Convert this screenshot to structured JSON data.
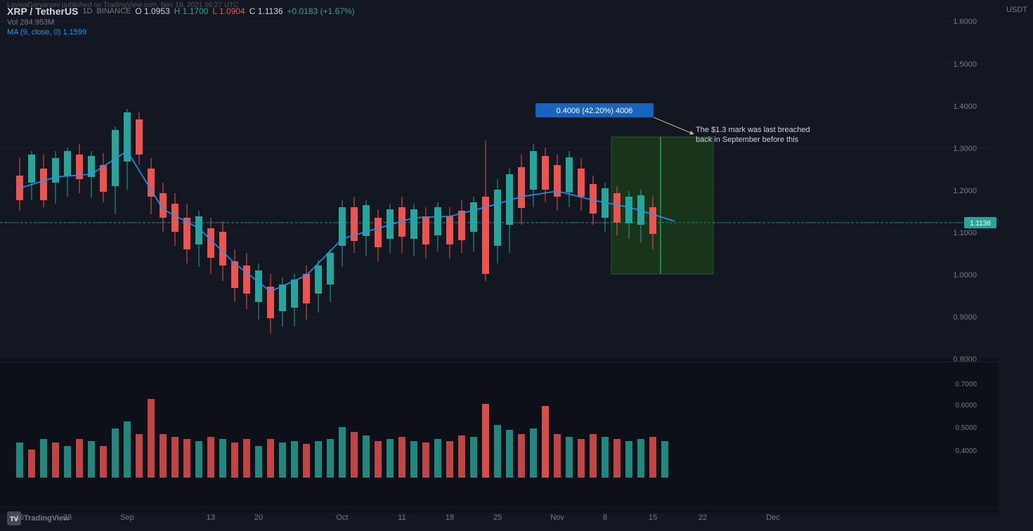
{
  "header": {
    "publisher": "LavinaDaryanani published on TradingView.com, Nov 18, 2021 06:27 UTC",
    "symbol": "XRP / TetherUS",
    "exchange": "BINANCE",
    "timeframe": "1D",
    "open_label": "O",
    "open_value": "1.0953",
    "high_label": "H",
    "high_value": "1.1700",
    "low_label": "L",
    "low_value": "1.0904",
    "close_label": "C",
    "close_value": "1.1136",
    "change_value": "+0.0183 (+1.67%)",
    "vol_label": "Vol",
    "vol_value": "284.953M",
    "ma_label": "MA (9, close, 0)",
    "ma_value": "1.1599"
  },
  "price_axis": {
    "currency": "USDT",
    "levels": [
      {
        "label": "1.6000",
        "y_pct": 4
      },
      {
        "label": "1.5000",
        "y_pct": 12
      },
      {
        "label": "1.4000",
        "y_pct": 20
      },
      {
        "label": "1.3000",
        "y_pct": 28
      },
      {
        "label": "1.2000",
        "y_pct": 36
      },
      {
        "label": "1.1136",
        "y_pct": 42,
        "current": true
      },
      {
        "label": "1.1000",
        "y_pct": 44
      },
      {
        "label": "1.0000",
        "y_pct": 52
      },
      {
        "label": "0.9000",
        "y_pct": 60
      },
      {
        "label": "0.8000",
        "y_pct": 68
      },
      {
        "label": "0.7000",
        "y_pct": 76
      },
      {
        "label": "0.6000",
        "y_pct": 82
      },
      {
        "label": "0.5000",
        "y_pct": 87
      },
      {
        "label": "0.4000",
        "y_pct": 92
      }
    ]
  },
  "time_axis": {
    "labels": [
      {
        "label": "16",
        "x_pct": 2
      },
      {
        "label": "23",
        "x_pct": 7
      },
      {
        "label": "Sep",
        "x_pct": 12
      },
      {
        "label": "13",
        "x_pct": 20
      },
      {
        "label": "20",
        "x_pct": 26
      },
      {
        "label": "Oct",
        "x_pct": 36
      },
      {
        "label": "11",
        "x_pct": 46
      },
      {
        "label": "18",
        "x_pct": 52
      },
      {
        "label": "25",
        "x_pct": 58
      },
      {
        "label": "Nov",
        "x_pct": 64
      },
      {
        "label": "8",
        "x_pct": 72
      },
      {
        "label": "15",
        "x_pct": 80
      },
      {
        "label": "22",
        "x_pct": 86
      },
      {
        "label": "Dec",
        "x_pct": 94
      }
    ]
  },
  "annotation": {
    "box_text": "0.4006 (42.20%) 4006",
    "note_text": "The $1.3 mark was last breached\nback in September before this"
  },
  "current_price": {
    "value": "1.1136",
    "y_pct": 42
  },
  "colors": {
    "background": "#131722",
    "bull_candle": "#26a69a",
    "bear_candle": "#ef5350",
    "ma_line": "#2196f3",
    "grid_line": "#1e2330",
    "dotted_line": "#2a6b6b",
    "highlight_rect": "#2d5a2d",
    "annotation_bg": "#1565c0",
    "current_price_bg": "#26a69a",
    "vol_bull": "#26a69a",
    "vol_bear": "#ef5350"
  }
}
